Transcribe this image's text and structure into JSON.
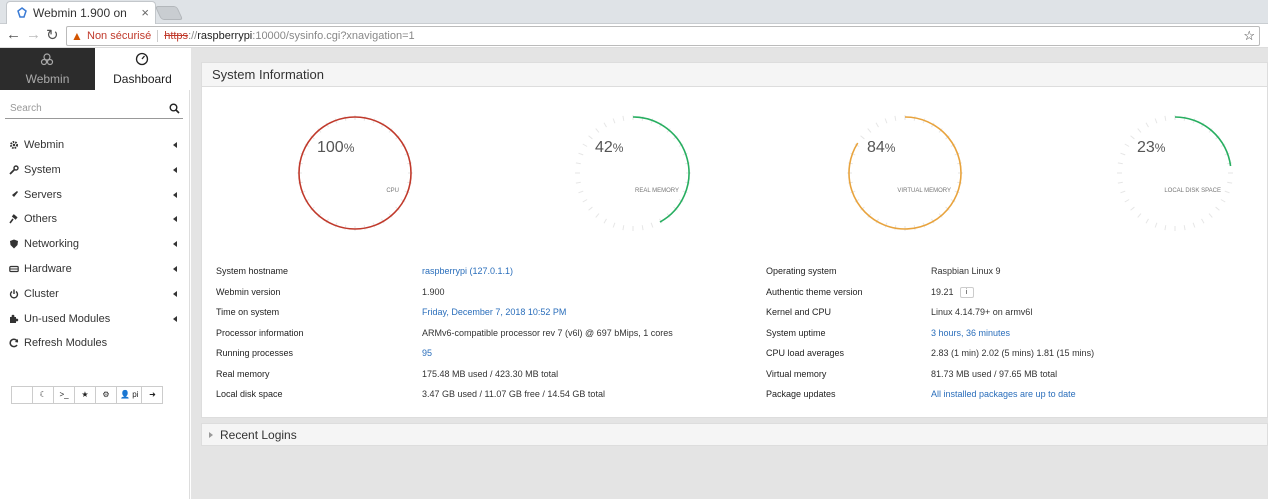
{
  "browser": {
    "tab_title": "Webmin 1.900 on",
    "tab_close": "×",
    "not_secure": "Non sécurisé",
    "url_scheme": "https",
    "url_sep": "://",
    "url_host": "raspberrypi",
    "url_rest": ":10000/sysinfo.cgi?xnavigation=1"
  },
  "sidebar": {
    "switch_webmin": "Webmin",
    "switch_dashboard": "Dashboard",
    "search_placeholder": "Search",
    "items": [
      {
        "label": "Webmin",
        "icon": "gear-icon"
      },
      {
        "label": "System",
        "icon": "wrench-icon"
      },
      {
        "label": "Servers",
        "icon": "rocket-icon"
      },
      {
        "label": "Others",
        "icon": "gavel-icon"
      },
      {
        "label": "Networking",
        "icon": "shield-icon"
      },
      {
        "label": "Hardware",
        "icon": "hdd-icon"
      },
      {
        "label": "Cluster",
        "icon": "power-icon"
      },
      {
        "label": "Un-used Modules",
        "icon": "puzzle-icon"
      },
      {
        "label": "Refresh Modules",
        "icon": "refresh-icon"
      }
    ],
    "toolbar_user": "pi"
  },
  "system_info": {
    "title": "System Information",
    "gauges": [
      {
        "value": 100,
        "label": "CPU",
        "color": "#c0392b"
      },
      {
        "value": 42,
        "label": "REAL MEMORY",
        "color": "#27ae60"
      },
      {
        "value": 84,
        "label": "VIRTUAL MEMORY",
        "color": "#e8a33d"
      },
      {
        "value": 23,
        "label": "LOCAL DISK SPACE",
        "color": "#27ae60"
      }
    ],
    "pct_sign": "%",
    "left_rows": [
      {
        "label": "System hostname",
        "value": "raspberrypi (127.0.1.1)",
        "link": true
      },
      {
        "label": "Webmin version",
        "value": "1.900",
        "link": false
      },
      {
        "label": "Time on system",
        "value": "Friday, December 7, 2018 10:52 PM",
        "link": true
      },
      {
        "label": "Processor information",
        "value": "ARMv6-compatible processor rev 7 (v6l) @ 697 bMips, 1 cores",
        "link": false
      },
      {
        "label": "Running processes",
        "value": "95",
        "link": true
      },
      {
        "label": "Real memory",
        "value": "175.48 MB used / 423.30 MB total",
        "link": false
      },
      {
        "label": "Local disk space",
        "value": "3.47 GB used / 11.07 GB free / 14.54 GB total",
        "link": false
      }
    ],
    "right_rows": [
      {
        "label": "Operating system",
        "value": "Raspbian Linux 9",
        "link": false
      },
      {
        "label": "Authentic theme version",
        "value": "19.21",
        "link": false
      },
      {
        "label": "Kernel and CPU",
        "value": "Linux 4.14.79+ on armv6l",
        "link": false
      },
      {
        "label": "System uptime",
        "value": "3 hours, 36 minutes",
        "link": true
      },
      {
        "label": "CPU load averages",
        "value": "2.83 (1 min) 2.02 (5 mins) 1.81 (15 mins)",
        "link": false
      },
      {
        "label": "Virtual memory",
        "value": "81.73 MB used / 97.65 MB total",
        "link": false
      },
      {
        "label": "Package updates",
        "value": "All installed packages are up to date",
        "link": true
      }
    ]
  },
  "recent_logins": {
    "title": "Recent Logins"
  }
}
